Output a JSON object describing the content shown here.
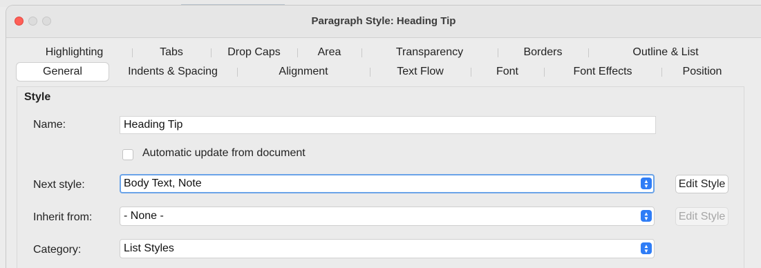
{
  "window": {
    "title": "Paragraph Style: Heading Tip"
  },
  "tabs": {
    "row1": [
      "Highlighting",
      "Tabs",
      "Drop Caps",
      "Area",
      "Transparency",
      "Borders",
      "Outline & List"
    ],
    "row2": [
      "General",
      "Indents & Spacing",
      "Alignment",
      "Text Flow",
      "Font",
      "Font Effects",
      "Position"
    ],
    "active": "General"
  },
  "style_section": {
    "title": "Style",
    "name_label": "Name:",
    "name_value": "Heading Tip",
    "auto_update_label": "Automatic update from document",
    "auto_update_checked": false,
    "next_style_label": "Next style:",
    "next_style_value": "Body Text, Note",
    "inherit_label": "Inherit from:",
    "inherit_value": "- None -",
    "category_label": "Category:",
    "category_value": "List Styles",
    "edit_style_label": "Edit Style",
    "edit_style_inherit_label": "Edit Style"
  },
  "colors": {
    "close_button": "#fe5f57",
    "select_arrow": "#2f7df6",
    "focus_ring": "#6aa3e8"
  }
}
